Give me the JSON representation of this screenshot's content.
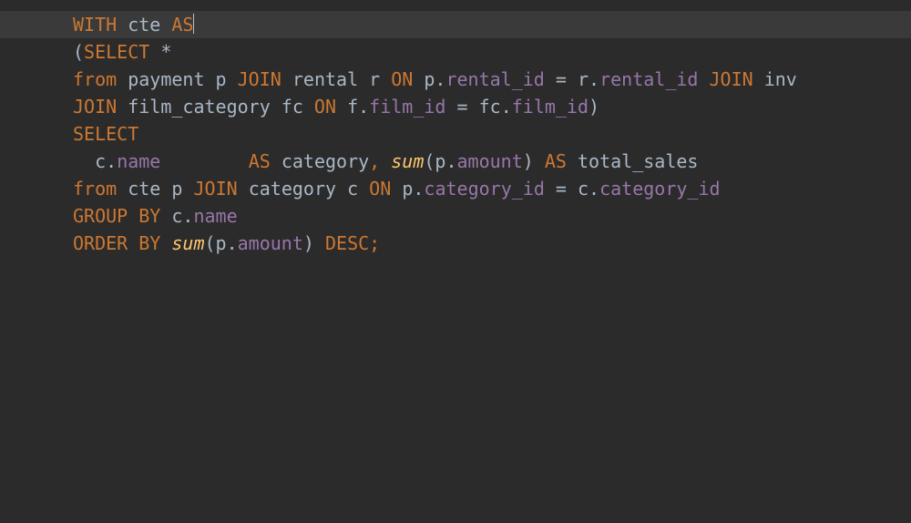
{
  "editor": {
    "language": "SQL",
    "theme": "darcula",
    "current_line_index": 0,
    "caret": {
      "line": 0,
      "after_token": "AS"
    },
    "lines": [
      {
        "tokens": [
          {
            "t": "WITH",
            "c": "kw"
          },
          {
            "t": " "
          },
          {
            "t": "cte",
            "c": "text"
          },
          {
            "t": " "
          },
          {
            "t": "AS",
            "c": "kw"
          }
        ],
        "has_caret": true
      },
      {
        "tokens": [
          {
            "t": "(",
            "c": "paren"
          },
          {
            "t": "SELECT",
            "c": "kw"
          },
          {
            "t": " "
          },
          {
            "t": "*",
            "c": "star"
          }
        ]
      },
      {
        "tokens": [
          {
            "t": "from",
            "c": "kw"
          },
          {
            "t": " "
          },
          {
            "t": "payment p",
            "c": "text"
          },
          {
            "t": " "
          },
          {
            "t": "JOIN",
            "c": "kw"
          },
          {
            "t": " "
          },
          {
            "t": "rental r",
            "c": "text"
          },
          {
            "t": " "
          },
          {
            "t": "ON",
            "c": "kw"
          },
          {
            "t": " "
          },
          {
            "t": "p",
            "c": "text"
          },
          {
            "t": ".",
            "c": "text"
          },
          {
            "t": "rental_id",
            "c": "col"
          },
          {
            "t": " "
          },
          {
            "t": "=",
            "c": "text"
          },
          {
            "t": " "
          },
          {
            "t": "r",
            "c": "text"
          },
          {
            "t": ".",
            "c": "text"
          },
          {
            "t": "rental_id",
            "c": "col"
          },
          {
            "t": " "
          },
          {
            "t": "JOIN",
            "c": "kw"
          },
          {
            "t": " "
          },
          {
            "t": "inv",
            "c": "text"
          }
        ]
      },
      {
        "tokens": [
          {
            "t": "JOIN",
            "c": "kw"
          },
          {
            "t": " "
          },
          {
            "t": "film_category fc",
            "c": "text"
          },
          {
            "t": " "
          },
          {
            "t": "ON",
            "c": "kw"
          },
          {
            "t": " "
          },
          {
            "t": "f",
            "c": "text"
          },
          {
            "t": ".",
            "c": "text"
          },
          {
            "t": "film_id",
            "c": "col"
          },
          {
            "t": " "
          },
          {
            "t": "=",
            "c": "text"
          },
          {
            "t": " "
          },
          {
            "t": "fc",
            "c": "text"
          },
          {
            "t": ".",
            "c": "text"
          },
          {
            "t": "film_id",
            "c": "col"
          },
          {
            "t": ")",
            "c": "paren"
          }
        ]
      },
      {
        "tokens": [
          {
            "t": "SELECT",
            "c": "kw"
          }
        ]
      },
      {
        "tokens": [
          {
            "t": "  "
          },
          {
            "t": "c",
            "c": "text"
          },
          {
            "t": ".",
            "c": "text"
          },
          {
            "t": "name",
            "c": "col"
          },
          {
            "t": "        "
          },
          {
            "t": "AS",
            "c": "kw"
          },
          {
            "t": " "
          },
          {
            "t": "category",
            "c": "text"
          },
          {
            "t": ",",
            "c": "kw"
          },
          {
            "t": " "
          },
          {
            "t": "sum",
            "c": "fn"
          },
          {
            "t": "(",
            "c": "paren"
          },
          {
            "t": "p",
            "c": "text"
          },
          {
            "t": ".",
            "c": "text"
          },
          {
            "t": "amount",
            "c": "col"
          },
          {
            "t": ")",
            "c": "paren"
          },
          {
            "t": " "
          },
          {
            "t": "AS",
            "c": "kw"
          },
          {
            "t": " "
          },
          {
            "t": "total_sales",
            "c": "text"
          }
        ]
      },
      {
        "tokens": [
          {
            "t": "from",
            "c": "kw"
          },
          {
            "t": " "
          },
          {
            "t": "cte p",
            "c": "text"
          },
          {
            "t": " "
          },
          {
            "t": "JOIN",
            "c": "kw"
          },
          {
            "t": " "
          },
          {
            "t": "category c",
            "c": "text"
          },
          {
            "t": " "
          },
          {
            "t": "ON",
            "c": "kw"
          },
          {
            "t": " "
          },
          {
            "t": "p",
            "c": "text"
          },
          {
            "t": ".",
            "c": "text"
          },
          {
            "t": "category_id",
            "c": "col"
          },
          {
            "t": " "
          },
          {
            "t": "=",
            "c": "text"
          },
          {
            "t": " "
          },
          {
            "t": "c",
            "c": "text"
          },
          {
            "t": ".",
            "c": "text"
          },
          {
            "t": "category_id",
            "c": "col"
          }
        ]
      },
      {
        "tokens": [
          {
            "t": "GROUP BY",
            "c": "kw"
          },
          {
            "t": " "
          },
          {
            "t": "c",
            "c": "text"
          },
          {
            "t": ".",
            "c": "text"
          },
          {
            "t": "name",
            "c": "col"
          }
        ]
      },
      {
        "tokens": [
          {
            "t": "ORDER BY",
            "c": "kw"
          },
          {
            "t": " "
          },
          {
            "t": "sum",
            "c": "fn"
          },
          {
            "t": "(",
            "c": "paren"
          },
          {
            "t": "p",
            "c": "text"
          },
          {
            "t": ".",
            "c": "text"
          },
          {
            "t": "amount",
            "c": "col"
          },
          {
            "t": ")",
            "c": "paren"
          },
          {
            "t": " "
          },
          {
            "t": "DESC",
            "c": "kw"
          },
          {
            "t": ";",
            "c": "kw"
          }
        ]
      }
    ]
  }
}
